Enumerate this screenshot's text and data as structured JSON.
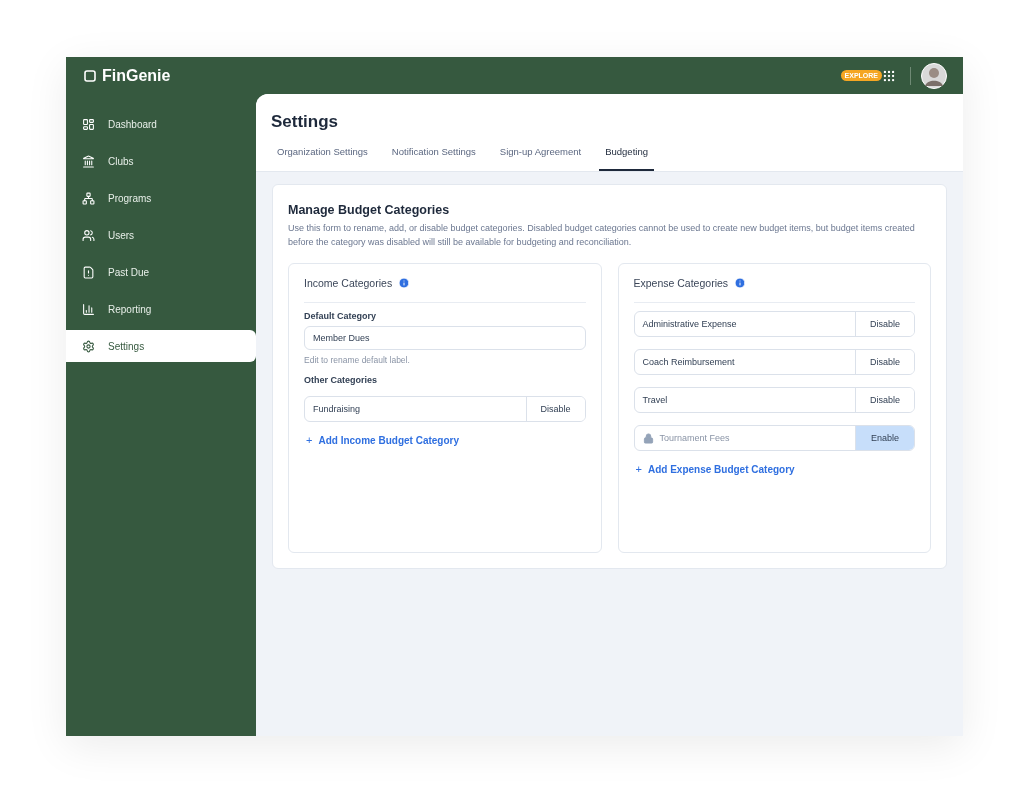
{
  "brand": {
    "name": "FinGenie"
  },
  "topbar": {
    "explore_badge": "EXPLORE"
  },
  "sidebar": {
    "items": [
      {
        "label": "Dashboard",
        "selected": false
      },
      {
        "label": "Clubs",
        "selected": false
      },
      {
        "label": "Programs",
        "selected": false
      },
      {
        "label": "Users",
        "selected": false
      },
      {
        "label": "Past Due",
        "selected": false
      },
      {
        "label": "Reporting",
        "selected": false
      },
      {
        "label": "Settings",
        "selected": true
      }
    ]
  },
  "page": {
    "title": "Settings",
    "tabs": [
      {
        "label": "Organization Settings",
        "selected": false
      },
      {
        "label": "Notification Settings",
        "selected": false
      },
      {
        "label": "Sign-up Agreement",
        "selected": false
      },
      {
        "label": "Budgeting",
        "selected": true
      }
    ]
  },
  "section": {
    "title": "Manage Budget Categories",
    "description": "Use this form to rename, add, or disable budget categories. Disabled budget categories cannot be used to create new budget items, but budget items created before the category was disabled will still be available for budgeting and reconciliation."
  },
  "income": {
    "title": "Income Categories",
    "default_label": "Default Category",
    "default_value": "Member Dues",
    "default_hint": "Edit to rename default label.",
    "other_label": "Other Categories",
    "categories": [
      {
        "name": "Fundraising",
        "disabled": false,
        "action": "Disable"
      }
    ],
    "add_plus": "+",
    "add_link": "Add Income Budget Category"
  },
  "expense": {
    "title": "Expense Categories",
    "categories": [
      {
        "name": "Administrative Expense",
        "disabled": false,
        "action": "Disable"
      },
      {
        "name": "Coach Reimbursement",
        "disabled": false,
        "action": "Disable"
      },
      {
        "name": "Travel",
        "disabled": false,
        "action": "Disable"
      },
      {
        "name": "Tournament Fees",
        "disabled": true,
        "action": "Enable"
      }
    ],
    "add_plus": "+",
    "add_link": "Add Expense Budget Category"
  }
}
